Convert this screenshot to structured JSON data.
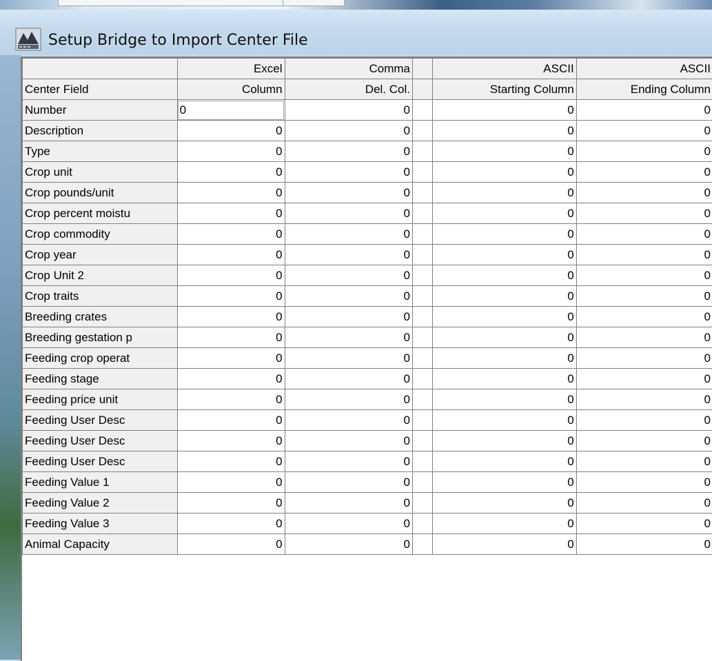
{
  "window": {
    "title": "Setup Bridge to Import Center File"
  },
  "grid": {
    "header_row1": [
      "",
      "Excel",
      "Comma",
      "",
      "ASCII",
      "ASCII"
    ],
    "header_row2": [
      "Center Field",
      "Column",
      "Del. Col.",
      "",
      "Starting Column",
      "Ending Column"
    ],
    "rows": [
      {
        "field": "Number",
        "excel": "0",
        "comma": "0",
        "start": "0",
        "end": "0"
      },
      {
        "field": "Description",
        "excel": "0",
        "comma": "0",
        "start": "0",
        "end": "0"
      },
      {
        "field": "Type",
        "excel": "0",
        "comma": "0",
        "start": "0",
        "end": "0"
      },
      {
        "field": "Crop unit",
        "excel": "0",
        "comma": "0",
        "start": "0",
        "end": "0"
      },
      {
        "field": "Crop pounds/unit",
        "excel": "0",
        "comma": "0",
        "start": "0",
        "end": "0"
      },
      {
        "field": "Crop percent moistu",
        "excel": "0",
        "comma": "0",
        "start": "0",
        "end": "0"
      },
      {
        "field": "Crop commodity",
        "excel": "0",
        "comma": "0",
        "start": "0",
        "end": "0"
      },
      {
        "field": "Crop year",
        "excel": "0",
        "comma": "0",
        "start": "0",
        "end": "0"
      },
      {
        "field": "Crop Unit 2",
        "excel": "0",
        "comma": "0",
        "start": "0",
        "end": "0"
      },
      {
        "field": "Crop traits",
        "excel": "0",
        "comma": "0",
        "start": "0",
        "end": "0"
      },
      {
        "field": "Breeding crates",
        "excel": "0",
        "comma": "0",
        "start": "0",
        "end": "0"
      },
      {
        "field": "Breeding gestation p",
        "excel": "0",
        "comma": "0",
        "start": "0",
        "end": "0"
      },
      {
        "field": "Feeding crop operat",
        "excel": "0",
        "comma": "0",
        "start": "0",
        "end": "0"
      },
      {
        "field": "Feeding stage",
        "excel": "0",
        "comma": "0",
        "start": "0",
        "end": "0"
      },
      {
        "field": "Feeding price unit",
        "excel": "0",
        "comma": "0",
        "start": "0",
        "end": "0"
      },
      {
        "field": "Feeding User Desc",
        "excel": "0",
        "comma": "0",
        "start": "0",
        "end": "0"
      },
      {
        "field": "Feeding User Desc",
        "excel": "0",
        "comma": "0",
        "start": "0",
        "end": "0"
      },
      {
        "field": "Feeding User Desc",
        "excel": "0",
        "comma": "0",
        "start": "0",
        "end": "0"
      },
      {
        "field": "Feeding Value 1",
        "excel": "0",
        "comma": "0",
        "start": "0",
        "end": "0"
      },
      {
        "field": "Feeding Value 2",
        "excel": "0",
        "comma": "0",
        "start": "0",
        "end": "0"
      },
      {
        "field": "Feeding Value 3",
        "excel": "0",
        "comma": "0",
        "start": "0",
        "end": "0"
      },
      {
        "field": "Animal Capacity",
        "excel": "0",
        "comma": "0",
        "start": "0",
        "end": "0"
      }
    ],
    "active_cell": {
      "row": 0,
      "column": "excel"
    }
  },
  "icons": {
    "app": "app-logo-icon"
  }
}
